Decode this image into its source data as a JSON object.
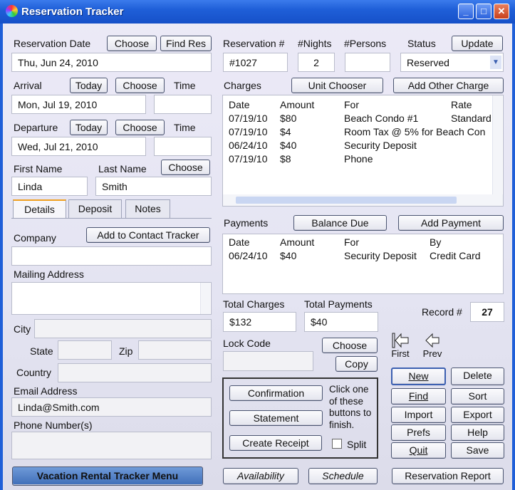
{
  "window": {
    "title": "Reservation Tracker",
    "min": "_",
    "max": "□",
    "close": "✕"
  },
  "left": {
    "reservation_date_label": "Reservation Date",
    "choose": "Choose",
    "find_res": "Find Res",
    "reservation_date": "Thu, Jun 24, 2010",
    "arrival_label": "Arrival",
    "today": "Today",
    "time_label": "Time",
    "arrival": "Mon, Jul 19, 2010",
    "arrival_time": "",
    "departure_label": "Departure",
    "departure": "Wed, Jul 21, 2010",
    "departure_time": "",
    "first_name_label": "First Name",
    "last_name_label": "Last Name",
    "first_name": "Linda",
    "last_name": "Smith",
    "tabs": [
      "Details",
      "Deposit",
      "Notes"
    ],
    "company_label": "Company",
    "add_contact": "Add to Contact Tracker",
    "company": "",
    "mailing_label": "Mailing Address",
    "city_label": "City",
    "state_label": "State",
    "zip_label": "Zip",
    "country_label": "Country",
    "email_label": "Email Address",
    "email": "Linda@Smith.com",
    "phone_label": "Phone Number(s)",
    "menu_button": "Vacation Rental Tracker Menu"
  },
  "right": {
    "res_num_label": "Reservation #",
    "nights_label": "#Nights",
    "persons_label": "#Persons",
    "status_label": "Status",
    "update": "Update",
    "res_num": "#1027",
    "nights": "2",
    "persons": "",
    "status": "Reserved",
    "charges_label": "Charges",
    "unit_chooser": "Unit Chooser",
    "add_other_charge": "Add Other Charge",
    "charges_headers": [
      "Date",
      "Amount",
      "For",
      "Rate"
    ],
    "charges": [
      [
        "07/19/10",
        "$80",
        "Beach Condo #1",
        "Standard"
      ],
      [
        "07/19/10",
        "$4",
        "Room Tax @ 5% for Beach Con",
        ""
      ],
      [
        "06/24/10",
        "$40",
        "Security Deposit",
        ""
      ],
      [
        "07/19/10",
        "$8",
        "Phone",
        ""
      ]
    ],
    "payments_label": "Payments",
    "balance_due": "Balance Due",
    "add_payment": "Add Payment",
    "payments_headers": [
      "Date",
      "Amount",
      "For",
      "By"
    ],
    "payments": [
      [
        "06/24/10",
        "$40",
        "Security Deposit",
        "Credit Card"
      ]
    ],
    "total_charges_label": "Total Charges",
    "total_payments_label": "Total Payments",
    "total_charges": "$132",
    "total_payments": "$40",
    "record_label": "Record #",
    "record": "27",
    "lock_code_label": "Lock Code",
    "choose": "Choose",
    "copy": "Copy",
    "lock_code": "",
    "confirmation": "Confirmation",
    "statement": "Statement",
    "create_receipt": "Create Receipt",
    "finish_hint": "Click one of these buttons to finish.",
    "split": "Split",
    "first": "First",
    "prev": "Prev",
    "new": "New",
    "delete": "Delete",
    "find": "Find",
    "sort": "Sort",
    "import": "Import",
    "export": "Export",
    "prefs": "Prefs",
    "help": "Help",
    "quit": "Quit",
    "save": "Save",
    "availability": "Availability",
    "schedule": "Schedule",
    "reservation_report": "Reservation Report"
  }
}
